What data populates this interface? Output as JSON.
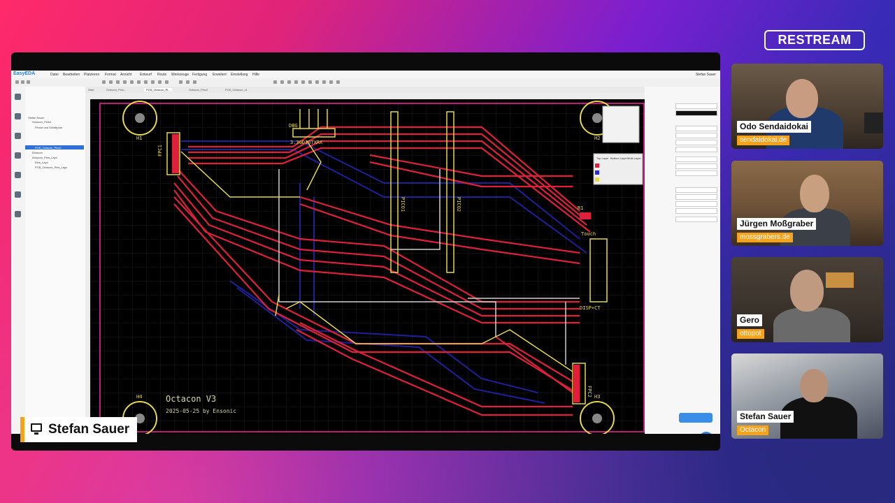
{
  "brand": {
    "logo_text": "RESTREAM"
  },
  "presenter": {
    "name": "Stefan Sauer",
    "icon": "monitor-icon"
  },
  "app": {
    "brand": "EasyEDA",
    "menus": [
      "Datei",
      "Bearbeiten",
      "Platzieren",
      "Format",
      "Ansicht",
      "Entwurf",
      "Route",
      "Werkzeuge",
      "Fertigung",
      "Erweitert",
      "Einstellung",
      "Hilfe"
    ],
    "user": "Stefan Sauer",
    "tabs": [
      "Start",
      "Octacon_Pins...",
      "PCB_Octacon_Pl...",
      "Octacon_Pins2",
      "PCB_Octacon_v1"
    ],
    "tree": [
      "Stefan Sauer",
      "Octacon_Pins2",
      "Pinout und Schaltplan",
      "PCB_Octacon_Pins2",
      "Octacon",
      "Octacon_Pins_Layo",
      "Pins_Layo",
      "PCB_Octacon_Pins_Layo"
    ],
    "board": {
      "title": "Octacon V3",
      "subtitle": "2025-05-25 by Ensonic",
      "labels": [
        "H1",
        "H2",
        "H3",
        "H4",
        "DBG",
        "3.3GDIOTXRX",
        "FPC1",
        "FPC2",
        "R1",
        "Touch",
        "DISP+CT",
        "PICO1",
        "PICO2"
      ]
    },
    "layer_panel": [
      "Top Layer",
      "Bottom Layer",
      "Multi-Layer"
    ]
  },
  "participants": [
    {
      "name": "Odo Sendaidokai",
      "handle": "sendaidokai.de"
    },
    {
      "name": "Jürgen Moßgraber",
      "handle": "mossgrabers.de"
    },
    {
      "name": "Gero",
      "handle": "ottopot"
    },
    {
      "name": "Stefan Sauer",
      "handle": "Octacon"
    }
  ],
  "colors": {
    "accent": "#f7a21b",
    "top_copper": "#e0203a",
    "bottom_copper": "#2a2ad0",
    "silkscreen": "#e6d84a",
    "board_outline": "#c01a7a"
  }
}
